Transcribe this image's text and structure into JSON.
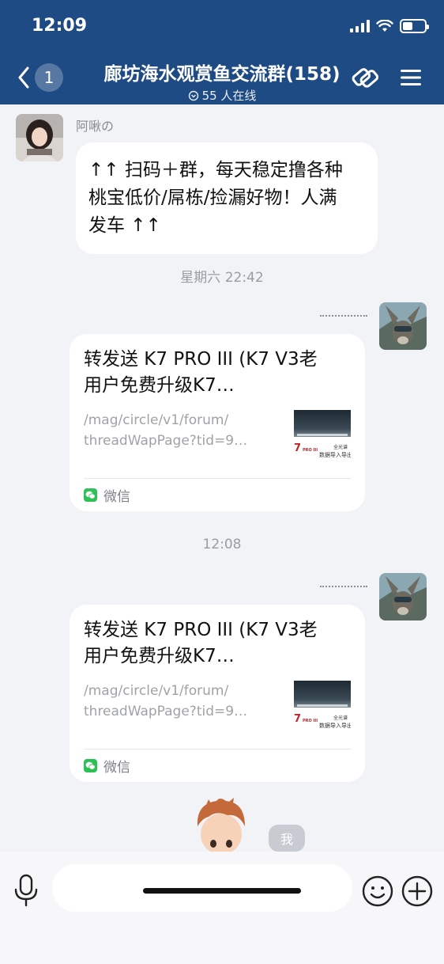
{
  "status_bar": {
    "time": "12:09"
  },
  "nav": {
    "unread_count": "1",
    "title": "廊坊海水观赏鱼交流群(158)",
    "online_text": "55 人在线"
  },
  "messages": {
    "first": {
      "sender": "阿啾の",
      "text_lines": [
        "↑↑ 扫码＋群，每天稳定撸各种",
        "桃宝低价/屌栋/捡漏好物！人满",
        "发车 ↑↑"
      ]
    },
    "time_1": "星期六 22:42",
    "card_1": {
      "title_line1": "转发送 K7 PRO III (K7 V3老",
      "title_line2": "用户免费升级K7…",
      "url_line1": "/mag/circle/v1/forum/",
      "url_line2": "threadWapPage?tid=9…",
      "thumb_text_1": "全光谱",
      "thumb_text_2": "数据导入导出",
      "thumb_logo": "7",
      "thumb_logo_sub": "PRO III",
      "source": "微信"
    },
    "time_2": "12:08",
    "card_2": {
      "title_line1": "转发送 K7 PRO III (K7 V3老",
      "title_line2": "用户免费升级K7…",
      "url_line1": "/mag/circle/v1/forum/",
      "url_line2": "threadWapPage?tid=9…",
      "thumb_text_1": "全光谱",
      "thumb_text_2": "数据导入导出",
      "thumb_logo": "7",
      "thumb_logo_sub": "PRO III",
      "source": "微信"
    },
    "me_tag": "我"
  },
  "input": {
    "placeholder": ""
  },
  "colors": {
    "header": "#1f4b85",
    "background": "#f2f3f7",
    "wechat_green": "#2ec156"
  }
}
